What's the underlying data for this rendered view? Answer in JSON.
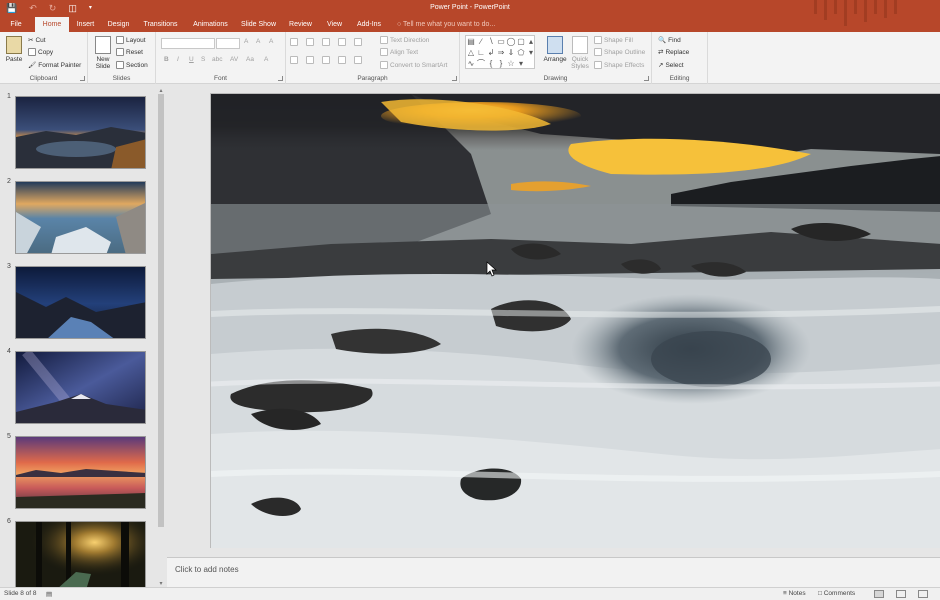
{
  "window": {
    "title": "Power Point - PowerPoint"
  },
  "qat_icons": [
    "save-icon",
    "undo-icon",
    "redo-icon",
    "start-from-beginning-icon",
    "customize-qat-icon"
  ],
  "tabs": [
    {
      "label": "File"
    },
    {
      "label": "Home"
    },
    {
      "label": "Insert"
    },
    {
      "label": "Design"
    },
    {
      "label": "Transitions"
    },
    {
      "label": "Animations"
    },
    {
      "label": "Slide Show"
    },
    {
      "label": "Review"
    },
    {
      "label": "View"
    },
    {
      "label": "Add-Ins"
    }
  ],
  "tell_me": "Tell me what you want to do...",
  "ribbon": {
    "clipboard": {
      "paste": "Paste",
      "cut": "Cut",
      "copy": "Copy",
      "format_painter": "Format Painter",
      "label": "Clipboard"
    },
    "slides": {
      "new_slide_1": "New",
      "new_slide_2": "Slide",
      "layout": "Layout",
      "reset": "Reset",
      "section": "Section",
      "label": "Slides"
    },
    "font": {
      "label": "Font",
      "bold": "B",
      "italic": "I",
      "underline": "U",
      "strike": "S",
      "shadow": "abc",
      "spacing": "AV",
      "case": "Aa",
      "grow": "A",
      "shrink": "A",
      "clear": "A"
    },
    "paragraph": {
      "label": "Paragraph",
      "text_direction": "Text Direction",
      "align_text": "Align Text",
      "convert_smartart": "Convert to SmartArt"
    },
    "drawing": {
      "label": "Drawing",
      "arrange": "Arrange",
      "quick_styles_1": "Quick",
      "quick_styles_2": "Styles",
      "shape_fill": "Shape Fill",
      "shape_outline": "Shape Outline",
      "shape_effects": "Shape Effects"
    },
    "editing": {
      "label": "Editing",
      "find": "Find",
      "replace": "Replace",
      "select": "Select"
    }
  },
  "slides": [
    {
      "number": "1"
    },
    {
      "number": "2"
    },
    {
      "number": "3"
    },
    {
      "number": "4"
    },
    {
      "number": "5"
    },
    {
      "number": "6"
    }
  ],
  "notes_placeholder": "Click to add notes",
  "status": {
    "slide_info": "Slide 8 of 8",
    "notes": "Notes",
    "comments": "Comments"
  },
  "colors": {
    "accent": "#b7472a",
    "ribbon": "#f3f3f3",
    "pane": "#e6e6e6"
  }
}
